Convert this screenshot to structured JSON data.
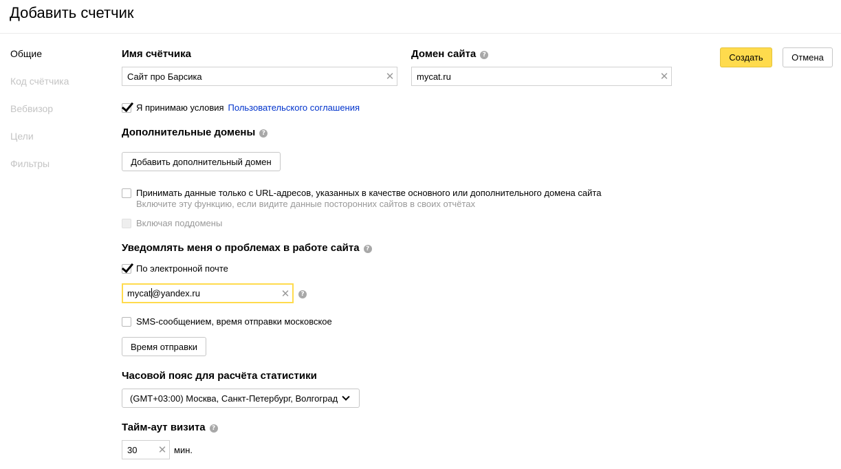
{
  "page": {
    "title": "Добавить счетчик"
  },
  "nav": {
    "items": [
      {
        "label": "Общие",
        "active": true
      },
      {
        "label": "Код счётчика",
        "active": false
      },
      {
        "label": "Вебвизор",
        "active": false
      },
      {
        "label": "Цели",
        "active": false
      },
      {
        "label": "Фильтры",
        "active": false
      }
    ]
  },
  "actions": {
    "create_label": "Создать",
    "cancel_label": "Отмена"
  },
  "counter_name": {
    "label": "Имя счётчика",
    "value": "Сайт про Барсика"
  },
  "site_domain": {
    "label": "Домен сайта",
    "value": "mycat.ru"
  },
  "terms": {
    "checked": true,
    "text": "Я принимаю условия",
    "link": "Пользовательского соглашения"
  },
  "extra_domains": {
    "label": "Дополнительные домены",
    "add_button": "Добавить дополнительный домен"
  },
  "url_filter": {
    "checked": false,
    "text": "Принимать данные только с URL-адресов, указанных в качестве основного или дополнительного домена сайта",
    "hint": "Включите эту функцию, если видите данные посторонних сайтов в своих отчётах"
  },
  "subdomains": {
    "checked": false,
    "disabled": true,
    "text": "Включая поддомены"
  },
  "notify": {
    "label": "Уведомлять меня о проблемах в работе сайта",
    "email_checkbox": {
      "checked": true,
      "text": "По электронной почте"
    },
    "email_before_caret": "mycat",
    "email_after_caret": "@yandex.ru",
    "sms_checkbox": {
      "checked": false,
      "text": "SMS-сообщением, время отправки московское"
    },
    "send_time_button": "Время отправки"
  },
  "timezone": {
    "label": "Часовой пояс для расчёта статистики",
    "selected": "(GMT+03:00) Москва, Санкт-Петербург, Волгоград"
  },
  "visit_timeout": {
    "label": "Тайм-аут визита",
    "value": "30",
    "unit": "мин."
  },
  "icons": {
    "help": "question-circle-icon",
    "clear": "cross-icon",
    "dropdown": "chevron-down-icon",
    "check": "checkmark-icon"
  },
  "colors": {
    "primary_button": "#ffdb4d",
    "link": "#0033cc",
    "focus_border": "#ffdb4d",
    "muted_text": "#999999"
  }
}
